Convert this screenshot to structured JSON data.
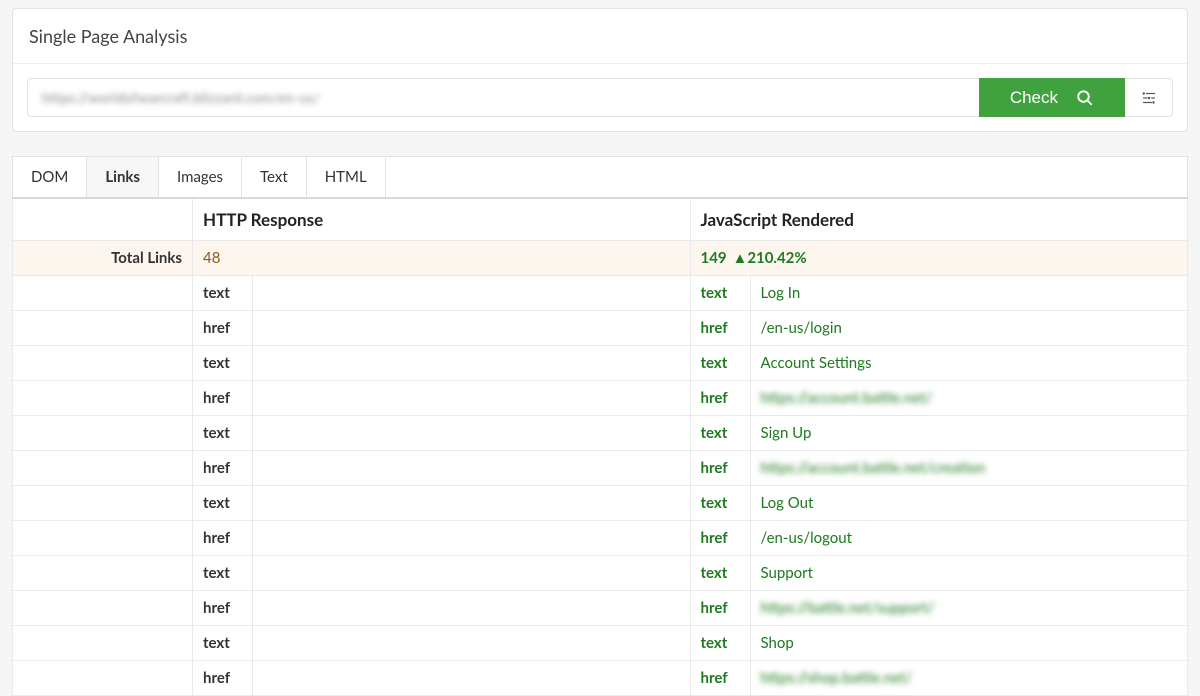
{
  "panel": {
    "title": "Single Page Analysis"
  },
  "urlbar": {
    "value_blurred": "https://worldofwarcraft.blizzard.com/en-us/",
    "check_label": "Check"
  },
  "tabs": {
    "items": [
      "DOM",
      "Links",
      "Images",
      "Text",
      "HTML"
    ],
    "active_index": 1
  },
  "columns": {
    "label_total": "Total Links",
    "http": "HTTP Response",
    "js": "JavaScript Rendered"
  },
  "totals": {
    "http": "48",
    "js": "149",
    "delta_arrow": "▲",
    "delta_pct": "210.42%"
  },
  "rows": [
    {
      "key": "text",
      "http": "",
      "js": "Log In",
      "js_blur": false
    },
    {
      "key": "href",
      "http": "",
      "js": "/en-us/login",
      "js_blur": false
    },
    {
      "key": "text",
      "http": "",
      "js": "Account Settings",
      "js_blur": false
    },
    {
      "key": "href",
      "http": "",
      "js": "https://account.battle.net/",
      "js_blur": true
    },
    {
      "key": "text",
      "http": "",
      "js": "Sign Up",
      "js_blur": false
    },
    {
      "key": "href",
      "http": "",
      "js": "https://account.battle.net/creation",
      "js_blur": true
    },
    {
      "key": "text",
      "http": "",
      "js": "Log Out",
      "js_blur": false
    },
    {
      "key": "href",
      "http": "",
      "js": "/en-us/logout",
      "js_blur": false
    },
    {
      "key": "text",
      "http": "",
      "js": "Support",
      "js_blur": false
    },
    {
      "key": "href",
      "http": "",
      "js": "https://battle.net/support/",
      "js_blur": true
    },
    {
      "key": "text",
      "http": "",
      "js": "Shop",
      "js_blur": false
    },
    {
      "key": "href",
      "http": "",
      "js": "https://shop.battle.net/",
      "js_blur": true
    }
  ]
}
